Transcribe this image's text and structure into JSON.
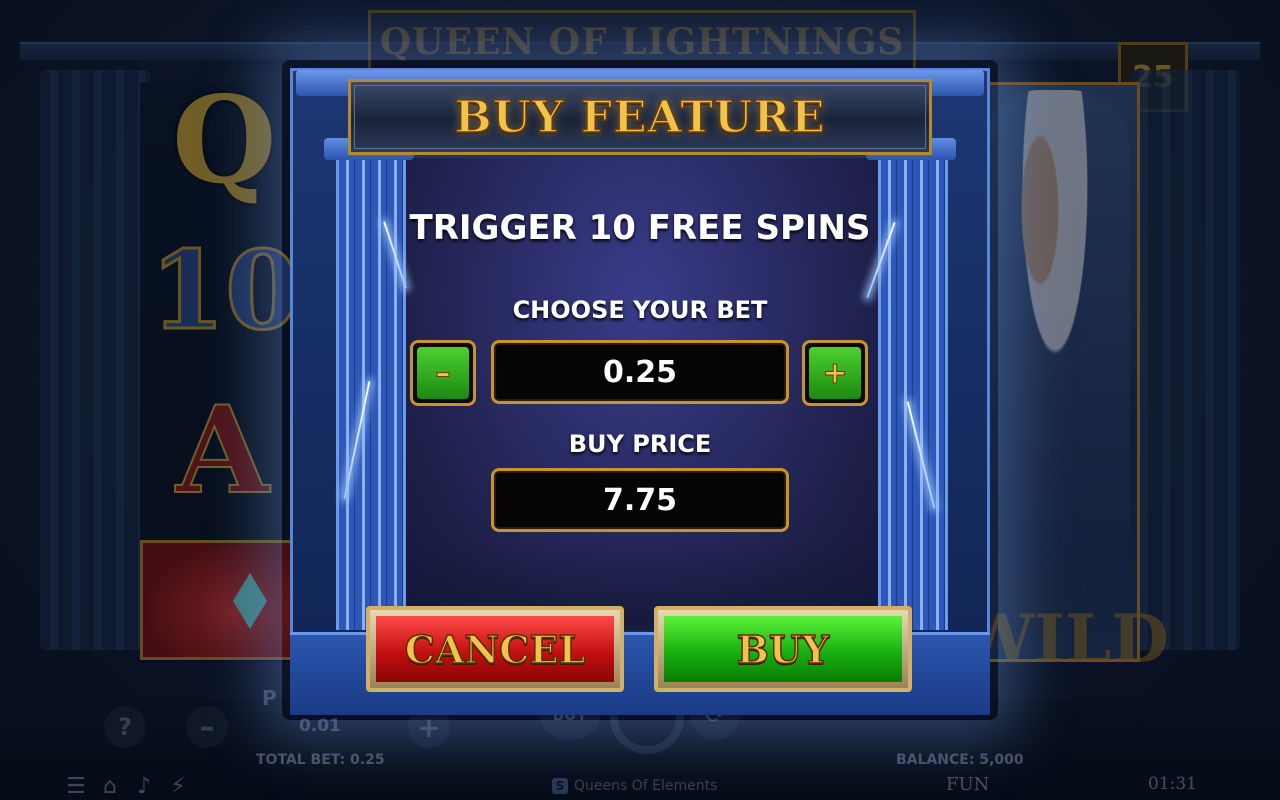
{
  "background": {
    "game_title": "QUEEN OF LIGHTNINGS",
    "lines_counter": "25",
    "symbols": [
      "Q",
      "10",
      "A"
    ],
    "wild_label": "WILD"
  },
  "modal": {
    "title": "BUY FEATURE",
    "trigger_text": "TRIGGER 10 FREE SPINS",
    "choose_label": "CHOOSE YOUR BET",
    "bet_value": "0.25",
    "minus_label": "–",
    "plus_label": "+",
    "price_label": "BUY PRICE",
    "price_value": "7.75",
    "cancel_label": "CANCEL",
    "buy_label": "BUY"
  },
  "bottom_bar": {
    "help_label": "?",
    "minus_label": "–",
    "plus_label": "+",
    "p_label": "P",
    "bet_value": "0.01",
    "buy_label": "BUY",
    "total_bet": "TOTAL BET: 0.25",
    "balance": "BALANCE: 5,000",
    "mode": "FUN",
    "clock": "01:31",
    "game_name": "Queens Of Elements",
    "logo_letter": "S"
  },
  "icons": [
    "menu-icon",
    "home-icon",
    "sound-icon",
    "turbo-icon",
    "spin-icon",
    "autoplay-icon"
  ],
  "colors": {
    "gold_text": "#f1c34a",
    "cancel_red": "#c41010",
    "buy_green": "#18b010",
    "pillar_blue": "#2e58b8"
  }
}
